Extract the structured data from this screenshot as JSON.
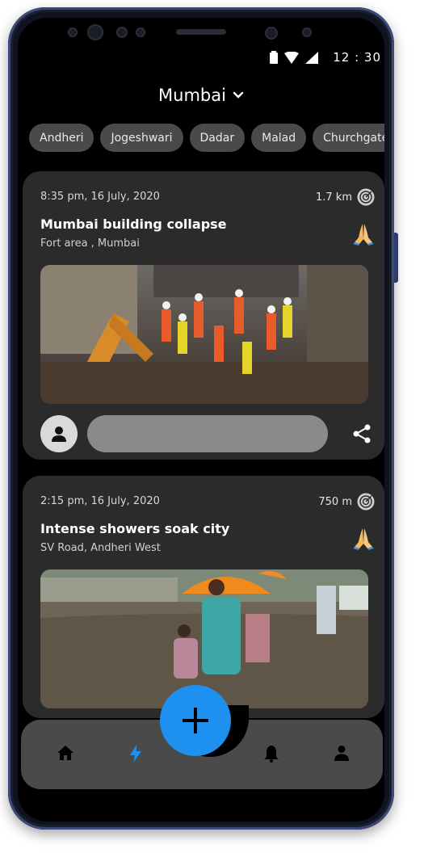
{
  "status_bar": {
    "time": "12 : 30",
    "icons": [
      "battery-icon",
      "wifi-icon",
      "signal-icon"
    ]
  },
  "header": {
    "city": "Mumbai",
    "dropdown_icon": "chevron-down-icon"
  },
  "chips": [
    "Andheri",
    "Jogeshwari",
    "Dadar",
    "Malad",
    "Churchgate"
  ],
  "posts": [
    {
      "timestamp": "8:35 pm, 16 July, 2020",
      "distance": "1.7 km",
      "title": "Mumbai building collapse",
      "location": "Fort area , Mumbai",
      "image": "building-collapse-rescue-photo"
    },
    {
      "timestamp": "2:15 pm, 16 July, 2020",
      "distance": "750 m",
      "title": "Intense showers soak city",
      "location": "SV Road, Andheri West",
      "image": "flooded-street-photo"
    }
  ],
  "colors": {
    "accent": "#1e90f0",
    "card": "#2b2b2b",
    "chip": "#4a4a4a",
    "background": "#000000"
  },
  "bottom_nav": [
    "home-icon",
    "flash-icon",
    "add-icon",
    "bell-icon",
    "profile-icon"
  ]
}
